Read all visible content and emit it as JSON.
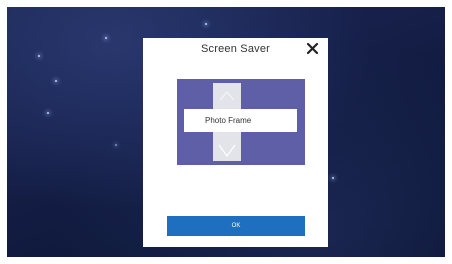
{
  "dialog": {
    "title": "Screen Saver",
    "close_icon": "close-icon"
  },
  "picker": {
    "selected_value": "Photo Frame",
    "up_icon": "up-arrow-icon",
    "down_icon": "down-arrow-icon"
  },
  "actions": {
    "ok_label": "OK"
  },
  "colors": {
    "panel": "#5f5fa8",
    "ok_button": "#1e6fc0",
    "background": "#16204a"
  }
}
